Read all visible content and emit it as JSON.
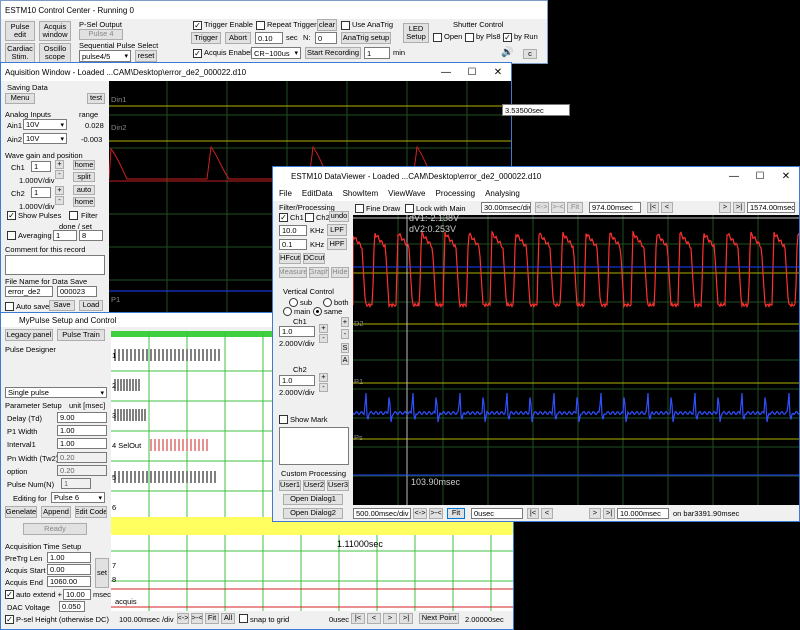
{
  "control_center": {
    "title": "ESTM10 Control Center - Running 0",
    "pulse_edit": "Pulse\nedit",
    "acquis_window": "Acquis\nwindow",
    "cardiac_stim": "Cardiac\nStim.",
    "oscilloscope": "Oscillo\nscope",
    "psel_output_label": "P-Sel Output",
    "pulse4": "Pulse 4",
    "seq_pulse_label": "Sequential Pulse Select",
    "seq_pulse_value": "pulse4/5",
    "reset": "reset",
    "trigger_enable": "Trigger Enable",
    "repeat_trigger": "Repeat Trigger",
    "clear": "clear",
    "use_anatrig": "Use AnaTrig",
    "trigger": "Trigger",
    "abort": "Abort",
    "sec_value": "0.10",
    "sec_unit": "sec",
    "n_label": "N:",
    "n_value": "0",
    "anatrig_setup": "AnaTrig setup",
    "led_setup": "LED\nSetup",
    "shutter_label": "Shutter Control",
    "open": "Open",
    "by_pls8": "by Pls8",
    "by_run": "by Run",
    "acquis_enable": "Acquis Enabel",
    "cr_value": "CR~100us",
    "start_recording": "Start Recording",
    "min_value": "1",
    "min_unit": "min",
    "c_btn": "c"
  },
  "acq_window": {
    "title": "Aquisition Window - Loaded ...CAM\\Desktop\\error_de2_000022.d10",
    "saving_data": "Saving Data",
    "menu": "Menu",
    "test": "test",
    "analog_inputs": "Analog Inputs",
    "range": "range",
    "ain1": "Ain1",
    "ain1_range": "10V",
    "ain1_val": "0.028",
    "ain2": "Ain2",
    "ain2_range": "10V",
    "ain2_val": "-0.003",
    "wave_gain": "Wave gain and position",
    "ch1": "Ch1",
    "ch1_gain": "1",
    "ch1_scale": "1.000V/div",
    "home1": "home",
    "split": "split",
    "ch2": "Ch2",
    "ch2_gain": "1",
    "ch2_scale": "1.000V/div",
    "auto": "auto",
    "home2": "home",
    "show_pulses": "Show Pulses",
    "filter": "Filter",
    "done_set": "done /  set",
    "averaging": "Averaging",
    "avg_done": "1",
    "avg_set": "8",
    "comment_label": "Comment for this record",
    "filename_label": "File Name for Data Save",
    "filename": "error_de2",
    "filenum": "000023",
    "auto_save": "Auto save",
    "save": "Save",
    "load": "Load",
    "ch_labels": [
      "Din1",
      "Din2",
      "P1"
    ],
    "time_readout": "3.53500sec"
  },
  "pulse_setup": {
    "title": "MyPulse Setup and Control",
    "legacy_panel": "Legacy panel",
    "pulse_train": "Pulse Train",
    "pulse_designer": "Pulse Designer",
    "single_pulse": "Single pulse",
    "param_setup": "Parameter Setup",
    "unit_msec": "unit [msec]",
    "delay_label": "Delay (Td)",
    "delay_val": "9.00",
    "p1w_label": "P1 Width",
    "p1w_val": "1.00",
    "interval_label": "Interval1",
    "interval_val": "1.00",
    "pnw_label": "Pn Width (Tw2)",
    "pnw_val": "0.20",
    "option_label": "option",
    "option_val": "0.20",
    "pulsenum_label": "Pulse Num(N)",
    "pulsenum_val": "1",
    "editing_for": "Editing for",
    "editing_val": "Pulse 6",
    "generate": "Genelate",
    "append": "Append",
    "edit_code": "Edit Code",
    "ready": "Ready",
    "acq_time_setup": "Acquisition Time Setup",
    "pretrg_label": "PreTrg Len",
    "pretrg_val": "1.00",
    "acqstart_label": "Acquis Start",
    "acqstart_val": "0.00",
    "acqend_label": "Acquis End",
    "acqend_val": "1060.00",
    "set": "set",
    "auto": "auto",
    "extend": "extend +",
    "extend_val": "10.00",
    "msec": "msec",
    "dac_voltage": "DAC Voltage",
    "dac_val": "0.050",
    "psel_height": "P-sel Height (otherwise DC)",
    "track_labels": [
      "1",
      "2",
      "3",
      "4 SelOut",
      "5",
      "6",
      "7",
      "8"
    ],
    "time_readout": "1.11000sec",
    "acquis_label": "acquis",
    "msdiv": "100.00msec /div",
    "fit": "Fit",
    "all": "All",
    "snap_to_grid": "snap to grid",
    "usec": "0usec",
    "next_point": "Next Point",
    "total_time": "2.00000sec"
  },
  "viewer": {
    "title": "ESTM10 DataViewer - Loaded ...CAM\\Desktop\\error_de2_000022.d10",
    "menus": [
      "File",
      "EditData",
      "ShowItem",
      "ViewWave",
      "Processing",
      "Analysing"
    ],
    "filter_processing": "Filter/Processing",
    "ch1": "Ch1",
    "ch2": "Ch2",
    "undo": "undo",
    "lpf_val": "10.0",
    "khz1": "KHz",
    "lpf": "LPF",
    "hpf_val": "0.1",
    "khz2": "KHz",
    "hpf": "HPF",
    "hfcut": "HFcut",
    "dccut": "DCcut",
    "measure": "Measure",
    "graph": "Graph",
    "hide": "Hide",
    "vertical_control": "Vertical Control",
    "sub": "sub",
    "both": "both",
    "main": "main",
    "same": "same",
    "vch1": "Ch1",
    "vch1_gain": "1.0",
    "vch1_scale": "2.000V/div",
    "vch2": "Ch2",
    "vch2_gain": "1.0",
    "vch2_scale": "2.000V/div",
    "s_btn": "S",
    "a_btn": "A",
    "show_mark": "Show Mark",
    "custom_processing": "Custom Processing",
    "user1": "User1",
    "user2": "User2",
    "user3": "User3",
    "open_dialog1": "Open Dialog1",
    "open_dialog2": "Open Dialog2",
    "fine_draw": "Fine Draw",
    "lock_with_main": "Lock with Main",
    "msec_div": "30.00msec/div",
    "fit": "Fit",
    "pos_msec": "974.00msec",
    "end_msec": "1574.00msec",
    "dv1": "dV1:-2.138V",
    "dv2": "dV2:0.253V",
    "time_mark": "103.90msec",
    "ch_labels": [
      "D2",
      "P1",
      "Ps"
    ],
    "bottom_msdiv": "500.00msec/div",
    "bottom_fit": "Fit",
    "bottom_usec": "0usec",
    "bottom_pos": "10.000msec",
    "on_bar": "on bar3391.90msec"
  }
}
